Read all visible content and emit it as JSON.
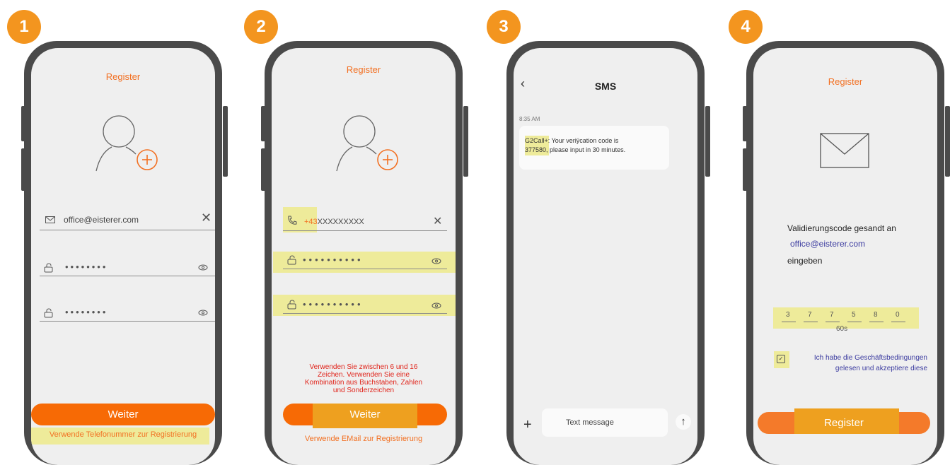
{
  "steps": [
    "1",
    "2",
    "3",
    "4"
  ],
  "colors": {
    "accent": "#f27022",
    "button": "#f76a05",
    "badge": "#f3951f",
    "highlight": "#eeeb9a",
    "note": "#e0241b",
    "link_blue": "#3c3ca0"
  },
  "phone1": {
    "title": "Register",
    "email": "office@eisterer.com",
    "password1": "••••••••",
    "password2": "••••••••",
    "button": "Weiter",
    "link": "Verwende Telefonummer zur Registrierung"
  },
  "phone2": {
    "title": "Register",
    "phone_prefix": "+43",
    "phone_rest": "XXXXXXXXX",
    "password1": "••••••••••",
    "password2": "••••••••••",
    "note": "Verwenden Sie zwischen 6 und 16 Zeichen. Verwenden Sie eine Kombination aus Buchstaben, Zahlen und Sonderzeichen",
    "button": "Weiter",
    "link": "Verwende EMail zur Registrierung"
  },
  "phone3": {
    "title": "SMS",
    "time": "8:35 AM",
    "sender": "G2Call",
    "message_rest": "+: Your veriÿcation code is",
    "message_line2": "377580, please input in 30 minutes.",
    "input_placeholder": "Text message"
  },
  "phone4": {
    "title": "Register",
    "sent_to": "Validierungscode gesandt an",
    "email": "office@eisterer.com",
    "enter": "eingeben",
    "code": [
      "3",
      "7",
      "7",
      "5",
      "8",
      "0"
    ],
    "timer": "60s",
    "terms_line1": "Ich habe die Geschäftsbedingungen",
    "terms_line2": "gelesen und akzeptiere diese",
    "button": "Register"
  }
}
